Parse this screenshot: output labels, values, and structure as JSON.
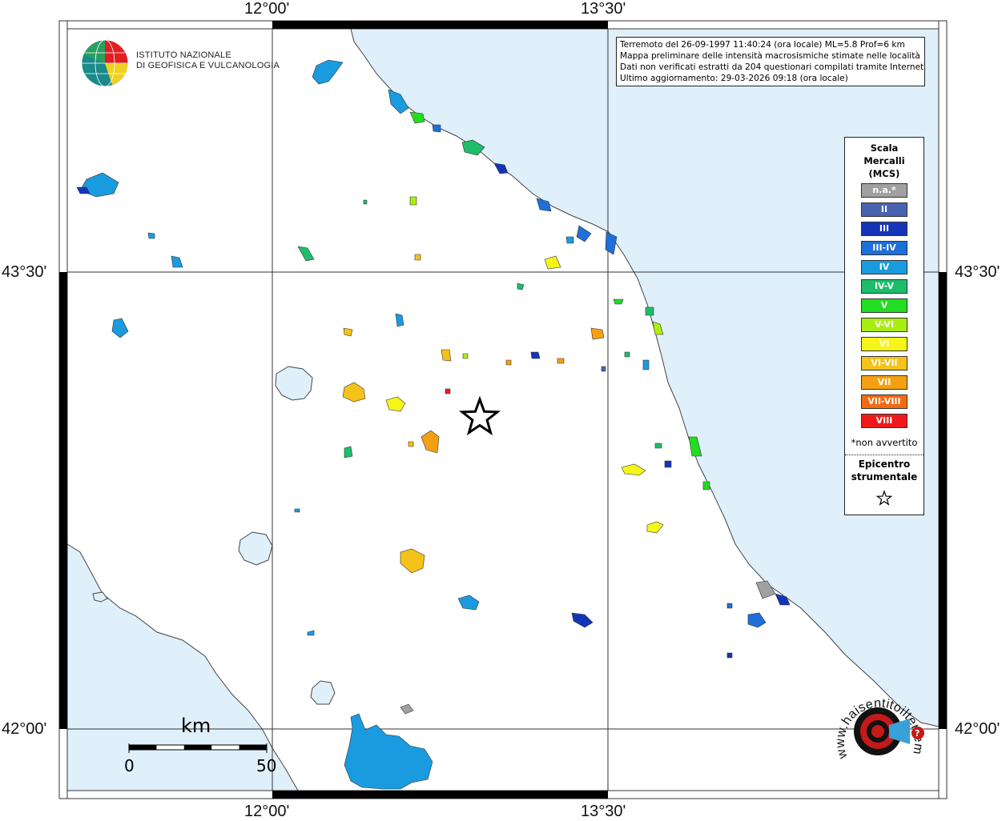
{
  "coordinates": {
    "lon_left": "12°00'",
    "lon_right": "13°30'",
    "lat_top": "43°30'",
    "lat_bottom": "42°00'"
  },
  "info": {
    "line1": "Terremoto del 26-09-1997 11:40:24 (ora locale) ML=5.8 Prof=6 km",
    "line2": "Mappa preliminare delle intensità macrosismiche stimate nelle località",
    "line3": "Dati non verificati estratti da 204 questionari compilati tramite Internet.",
    "line4": "Ultimo aggiornamento: 29-03-2026 09:18 (ora locale)"
  },
  "institute": {
    "line1": "ISTITUTO NAZIONALE",
    "line2": "DI GEOFISICA E VULCANOLOGIA"
  },
  "legend": {
    "title1": "Scala",
    "title2": "Mercalli",
    "title3": "(MCS)",
    "classes": [
      {
        "label": "n.a.*",
        "color": "#a0a0a0"
      },
      {
        "label": "II",
        "color": "#4a63b0"
      },
      {
        "label": "III",
        "color": "#1535b8"
      },
      {
        "label": "III-IV",
        "color": "#1e6fd8"
      },
      {
        "label": "IV",
        "color": "#1a9be0"
      },
      {
        "label": "IV-V",
        "color": "#1dbd6a"
      },
      {
        "label": "V",
        "color": "#22dd22"
      },
      {
        "label": "V-VI",
        "color": "#aaee11"
      },
      {
        "label": "VI",
        "color": "#f5f51a"
      },
      {
        "label": "VI-VII",
        "color": "#f5c21a"
      },
      {
        "label": "VII",
        "color": "#f5a012"
      },
      {
        "label": "VII-VIII",
        "color": "#f56a10"
      },
      {
        "label": "VIII",
        "color": "#ee1a1a"
      }
    ],
    "na_note": "*non avvertito",
    "epicenter1": "Epicentro",
    "epicenter2": "strumentale"
  },
  "scale": {
    "unit": "km",
    "min_label": "0",
    "max_label": "50"
  },
  "colors": {
    "sea": "#dff0fb",
    "land": "#ffffff"
  },
  "logo_text": "www.haisentitoilterremoto.it"
}
